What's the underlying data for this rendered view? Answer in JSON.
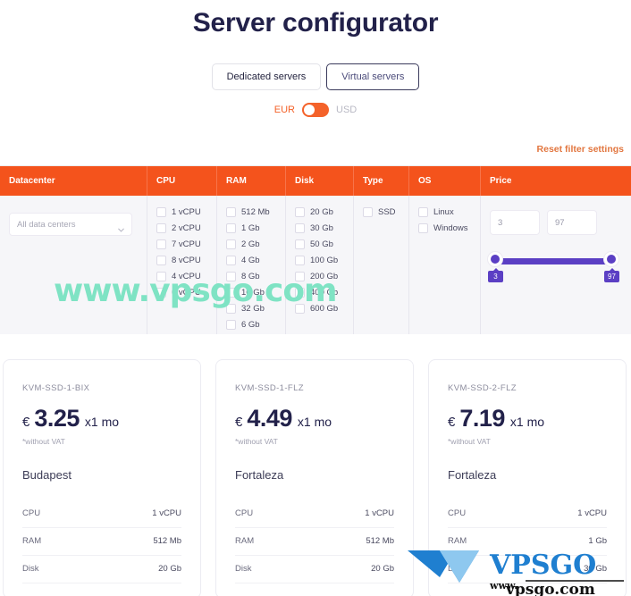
{
  "header": {
    "title": "Server configurator"
  },
  "tabs": [
    {
      "label": "Dedicated servers",
      "active": false
    },
    {
      "label": "Virtual servers",
      "active": true
    }
  ],
  "currency": {
    "left_label": "EUR",
    "right_label": "USD",
    "selected": "EUR",
    "accent_color": "#f4622a"
  },
  "reset": {
    "label": "Reset filter settings",
    "color": "#e2763f"
  },
  "filters": {
    "header_color": "#f4531c",
    "columns": [
      {
        "key": "datacenter",
        "label": "Datacenter"
      },
      {
        "key": "cpu",
        "label": "CPU"
      },
      {
        "key": "ram",
        "label": "RAM"
      },
      {
        "key": "disk",
        "label": "Disk"
      },
      {
        "key": "type",
        "label": "Type"
      },
      {
        "key": "os",
        "label": "OS"
      },
      {
        "key": "price",
        "label": "Price"
      }
    ],
    "datacenter": {
      "select_value": "All data centers"
    },
    "cpu": {
      "options": [
        "1 vCPU",
        "2 vCPU",
        "7 vCPU",
        "8 vCPU",
        "4 vCPU",
        "6 vCPU"
      ]
    },
    "ram": {
      "options": [
        "512 Mb",
        "1 Gb",
        "2 Gb",
        "4 Gb",
        "8 Gb",
        "16 Gb",
        "32 Gb",
        "6 Gb"
      ]
    },
    "disk": {
      "options": [
        "20 Gb",
        "30 Gb",
        "50 Gb",
        "100 Gb",
        "200 Gb",
        "400 Gb",
        "600 Gb"
      ]
    },
    "type": {
      "options": [
        "SSD"
      ]
    },
    "os": {
      "options": [
        "Linux",
        "Windows"
      ]
    },
    "price": {
      "min_value": "3",
      "max_value": "97",
      "min_bubble": "3",
      "max_bubble": "97",
      "slider_color": "#5b3fc4"
    }
  },
  "cards": [
    {
      "code": "KVM-SSD-1-BIX",
      "currency_symbol": "€",
      "amount": "3.25",
      "period": "x1 mo",
      "vat_note": "*without VAT",
      "city": "Budapest",
      "specs": [
        {
          "label": "CPU",
          "value": "1 vCPU"
        },
        {
          "label": "RAM",
          "value": "512 Mb"
        },
        {
          "label": "Disk",
          "value": "20 Gb"
        }
      ]
    },
    {
      "code": "KVM-SSD-1-FLZ",
      "currency_symbol": "€",
      "amount": "4.49",
      "period": "x1 mo",
      "vat_note": "*without VAT",
      "city": "Fortaleza",
      "specs": [
        {
          "label": "CPU",
          "value": "1 vCPU"
        },
        {
          "label": "RAM",
          "value": "512 Mb"
        },
        {
          "label": "Disk",
          "value": "20 Gb"
        }
      ]
    },
    {
      "code": "KVM-SSD-2-FLZ",
      "currency_symbol": "€",
      "amount": "7.19",
      "period": "x1 mo",
      "vat_note": "*without VAT",
      "city": "Fortaleza",
      "specs": [
        {
          "label": "CPU",
          "value": "1 vCPU"
        },
        {
          "label": "RAM",
          "value": "1 Gb"
        },
        {
          "label": "Disk",
          "value": "30 Gb"
        }
      ]
    }
  ],
  "watermark": {
    "text": "www.vpsgo.com",
    "color": "#7fe3c4",
    "logo_text": "VPSGO",
    "logo_sub": "www.",
    "logo_sub2": "vpsgo.com"
  }
}
